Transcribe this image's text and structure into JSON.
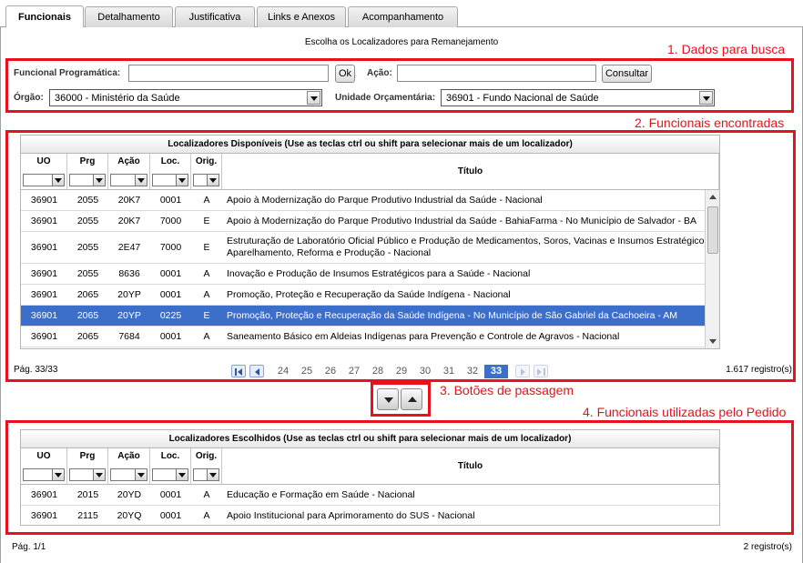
{
  "tabs": [
    {
      "label": "Funcionais",
      "active": true
    },
    {
      "label": "Detalhamento",
      "active": false
    },
    {
      "label": "Justificativa",
      "active": false
    },
    {
      "label": "Links e Anexos",
      "active": false
    },
    {
      "label": "Acompanhamento",
      "active": false
    }
  ],
  "page_title": "Escolha os Localizadores para Remanejamento",
  "callouts": {
    "c1": "1. Dados para busca",
    "c2": "2. Funcionais encontradas",
    "c3": "3. Botões de passagem",
    "c4": "4. Funcionais utilizadas pelo Pedido"
  },
  "search": {
    "funcional_label": "Funcional Programática:",
    "funcional_value": "",
    "ok_label": "Ok",
    "acao_label": "Ação:",
    "acao_value": "",
    "consultar_label": "Consultar",
    "orgao_label": "Órgão:",
    "orgao_value": "36000 - Ministério da Saúde",
    "unidade_label": "Unidade Orçamentária:",
    "unidade_value": "36901 - Fundo Nacional de Saúde"
  },
  "available": {
    "caption": "Localizadores Disponíveis (Use as teclas ctrl ou shift para selecionar mais de um localizador)",
    "columns": [
      "UO",
      "Prg",
      "Ação",
      "Loc.",
      "Orig.",
      "Título"
    ],
    "rows": [
      {
        "uo": "36901",
        "prg": "2055",
        "acao": "20K7",
        "loc": "0001",
        "orig": "A",
        "titulo": "Apoio à Modernização do Parque Produtivo Industrial da Saúde - Nacional"
      },
      {
        "uo": "36901",
        "prg": "2055",
        "acao": "20K7",
        "loc": "7000",
        "orig": "E",
        "titulo": "Apoio à Modernização do Parque Produtivo Industrial da Saúde - BahiaFarma - No Município de Salvador - BA"
      },
      {
        "uo": "36901",
        "prg": "2055",
        "acao": "2E47",
        "loc": "7000",
        "orig": "E",
        "titulo": "Estruturação de Laboratório Oficial Público e Produção de Medicamentos, Soros, Vacinas e Insumos Estratégicos - Aparelhamento, Reforma e Produção - Nacional"
      },
      {
        "uo": "36901",
        "prg": "2055",
        "acao": "8636",
        "loc": "0001",
        "orig": "A",
        "titulo": "Inovação e Produção de Insumos Estratégicos para a Saúde - Nacional"
      },
      {
        "uo": "36901",
        "prg": "2065",
        "acao": "20YP",
        "loc": "0001",
        "orig": "A",
        "titulo": "Promoção, Proteção e Recuperação da Saúde Indígena - Nacional"
      },
      {
        "uo": "36901",
        "prg": "2065",
        "acao": "20YP",
        "loc": "0225",
        "orig": "E",
        "titulo": "Promoção, Proteção e Recuperação da Saúde Indígena - No Município de São Gabriel da Cachoeira - AM",
        "selected": true
      },
      {
        "uo": "36901",
        "prg": "2065",
        "acao": "7684",
        "loc": "0001",
        "orig": "A",
        "titulo": "Saneamento Básico em Aldeias Indígenas para Prevenção e Controle de Agravos - Nacional"
      }
    ],
    "page_label": "Pág. 33/33",
    "count_label": "1.617 registro(s)",
    "pages": [
      "24",
      "25",
      "26",
      "27",
      "28",
      "29",
      "30",
      "31",
      "32",
      "33"
    ],
    "current_page": "33"
  },
  "chosen": {
    "caption": "Localizadores Escolhidos (Use as teclas ctrl ou shift para selecionar mais de um localizador)",
    "columns": [
      "UO",
      "Prg",
      "Ação",
      "Loc.",
      "Orig.",
      "Título"
    ],
    "rows": [
      {
        "uo": "36901",
        "prg": "2015",
        "acao": "20YD",
        "loc": "0001",
        "orig": "A",
        "titulo": "Educação e Formação em Saúde - Nacional"
      },
      {
        "uo": "36901",
        "prg": "2115",
        "acao": "20YQ",
        "loc": "0001",
        "orig": "A",
        "titulo": "Apoio Institucional para Aprimoramento do SUS - Nacional"
      }
    ],
    "page_label": "Pág. 1/1",
    "count_label": "2 registro(s)"
  },
  "colors": {
    "accent_red": "#e8121f",
    "selection_blue": "#3b6fc9"
  }
}
